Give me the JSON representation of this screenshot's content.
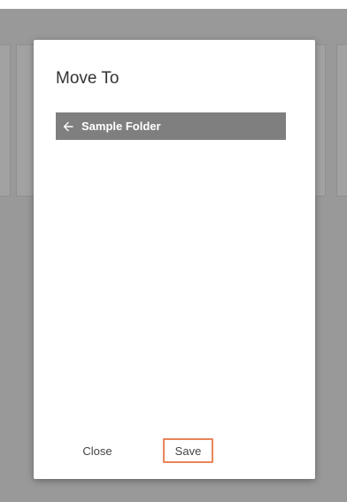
{
  "dialog": {
    "title": "Move To",
    "current_folder": {
      "icon": "arrow-left-icon",
      "label": "Sample Folder"
    },
    "buttons": {
      "close_label": "Close",
      "save_label": "Save"
    }
  },
  "colors": {
    "overlay": "#999999",
    "folder_bar": "#7f7f7f",
    "save_highlight": "#e8855a"
  }
}
